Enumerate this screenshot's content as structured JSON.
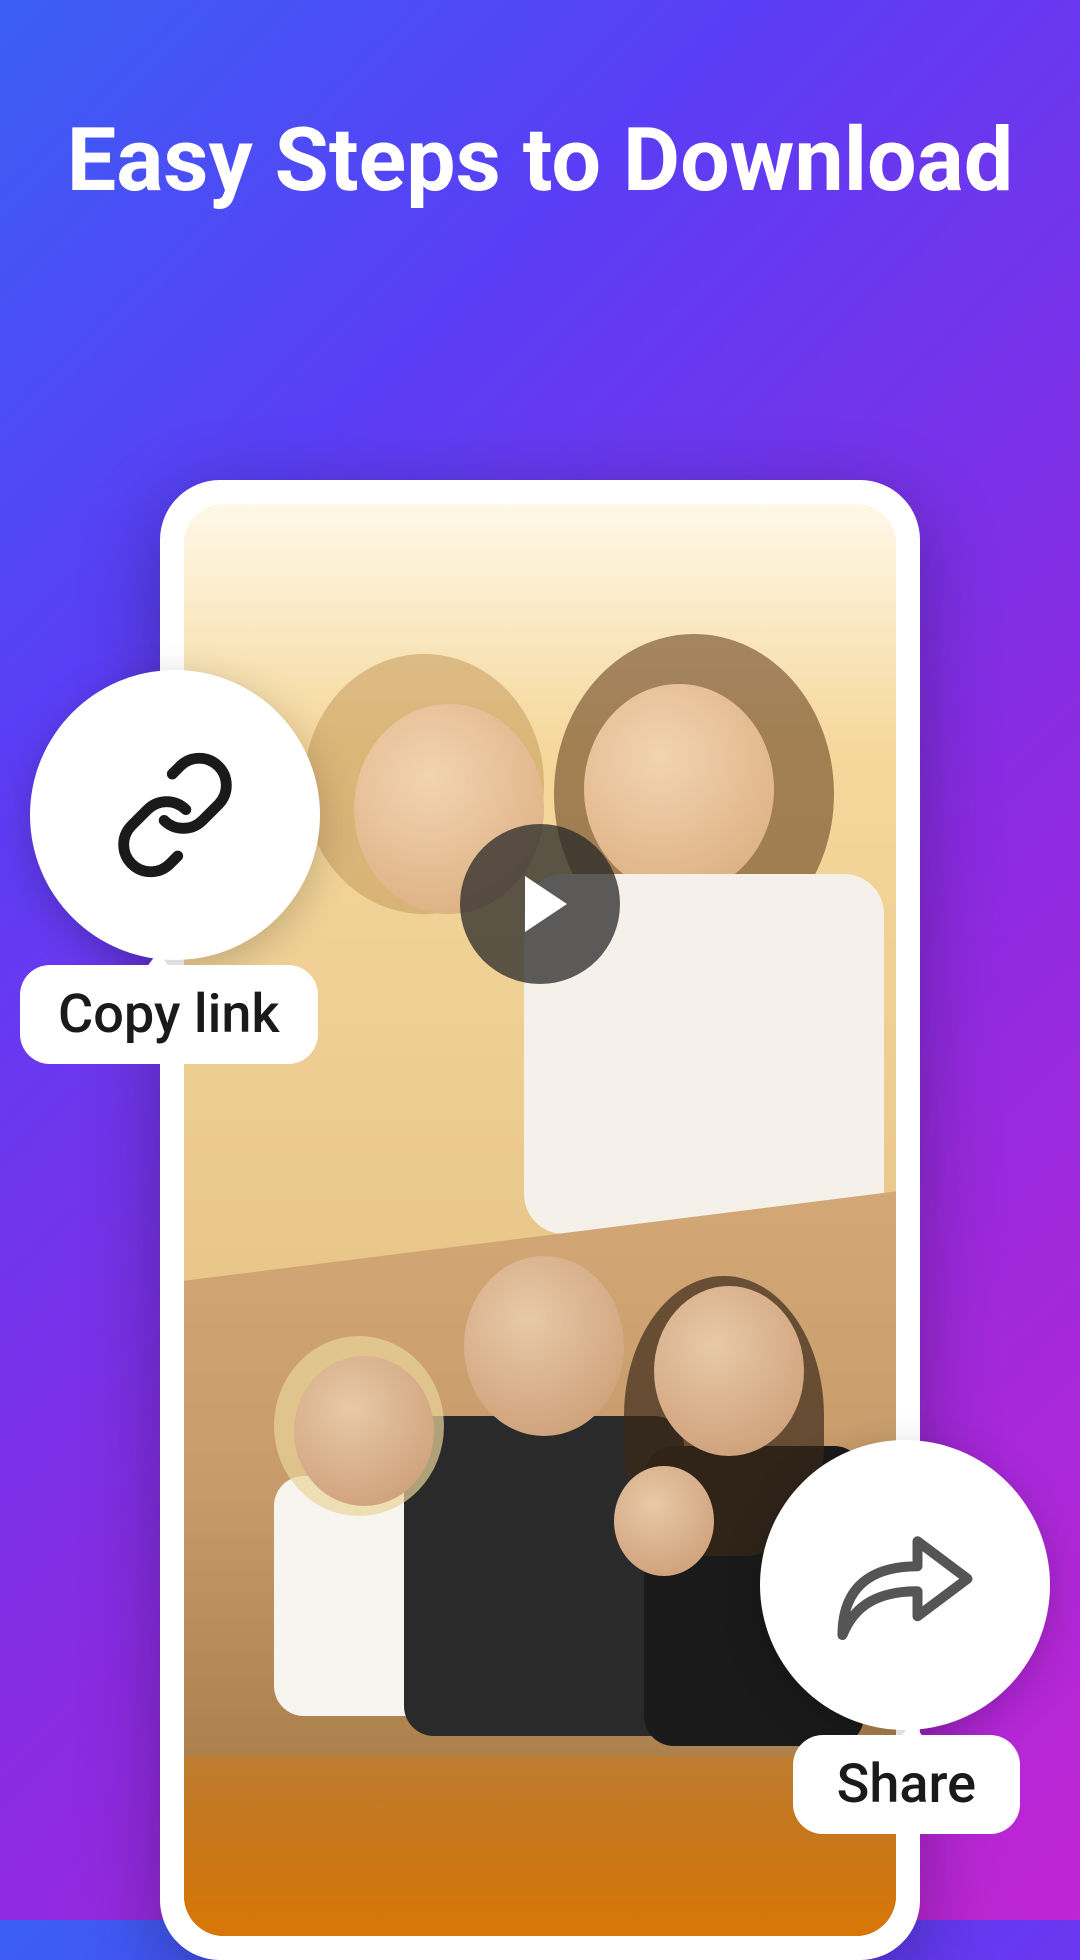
{
  "title": "Easy Steps to Download",
  "actions": {
    "copy_link_label": "Copy link",
    "share_label": "Share"
  },
  "icons": {
    "link": "link-icon",
    "share": "share-icon",
    "play": "play-icon"
  }
}
